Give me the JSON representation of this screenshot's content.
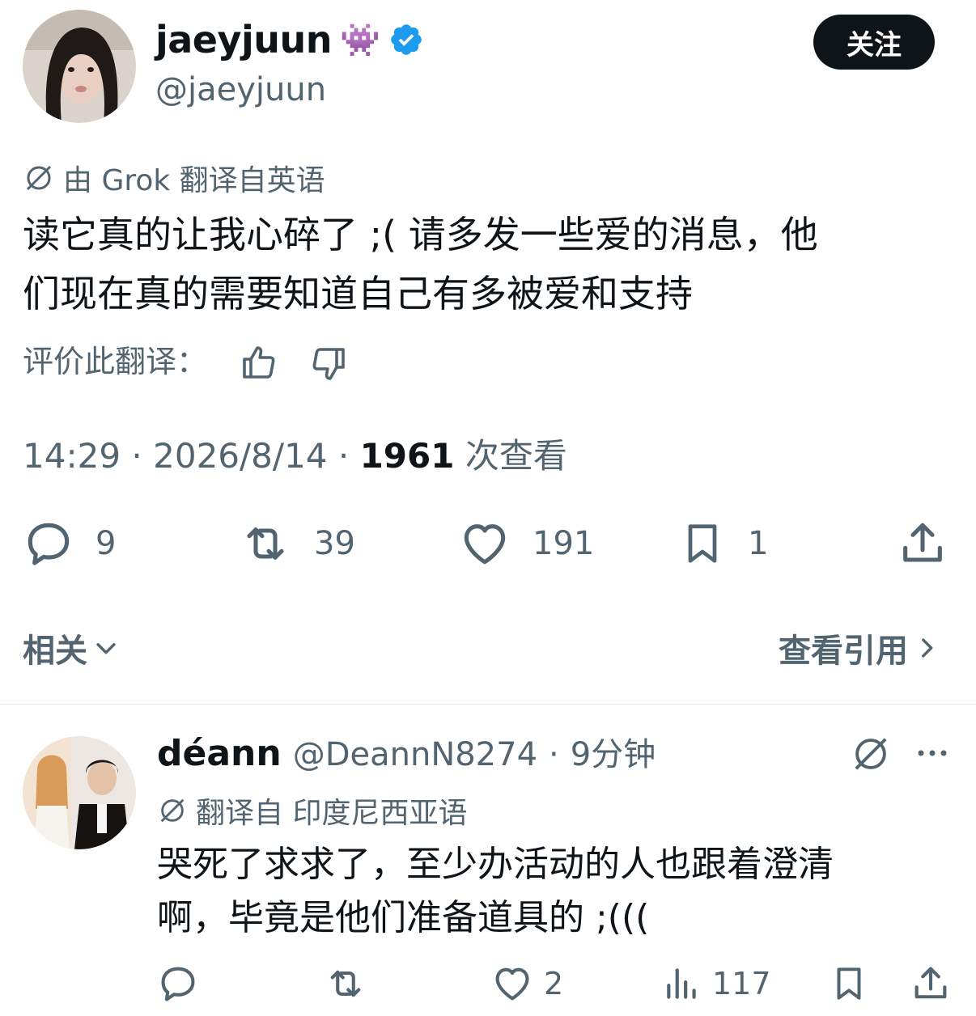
{
  "tweet": {
    "author_name": "jaeyjuun",
    "author_emoji": "👾",
    "author_handle": "@jaeyjuun",
    "follow_label": "关注",
    "translation_note": "由 Grok 翻译自英语",
    "text_line1": "读它真的让我心碎了 ;( 请多发一些爱的消息，他",
    "text_line2": "们现在真的需要知道自己有多被爱和支持",
    "rate_label": "评价此翻译：",
    "time": "14:29",
    "date": "2026/8/14",
    "views_count": "1961",
    "views_label": "次查看",
    "replies": "9",
    "reposts": "39",
    "likes": "191",
    "bookmarks": "1"
  },
  "section": {
    "related_label": "相关",
    "quotes_label": "查看引用"
  },
  "reply": {
    "author_name": "déann",
    "author_handle": "@DeannN8274",
    "time_ago": "9分钟",
    "translation_note": "翻译自 印度尼西亚语",
    "text_line1": "哭死了求求了，至少办活动的人也跟着澄清",
    "text_line2": "啊，毕竟是他们准备道具的 ;(((",
    "likes": "2",
    "views": "117"
  },
  "colors": {
    "verified": "#1d9bf0",
    "primary_text": "#0f1419",
    "secondary_text": "#536471",
    "follow_button_bg": "#0f1419"
  },
  "icons": {
    "verified": "verified-badge-icon",
    "translate": "grok-slash-icon",
    "reply": "speech-bubble-icon",
    "repost": "repost-arrows-icon",
    "like": "heart-icon",
    "bookmark": "bookmark-icon",
    "share": "share-upload-icon"
  }
}
